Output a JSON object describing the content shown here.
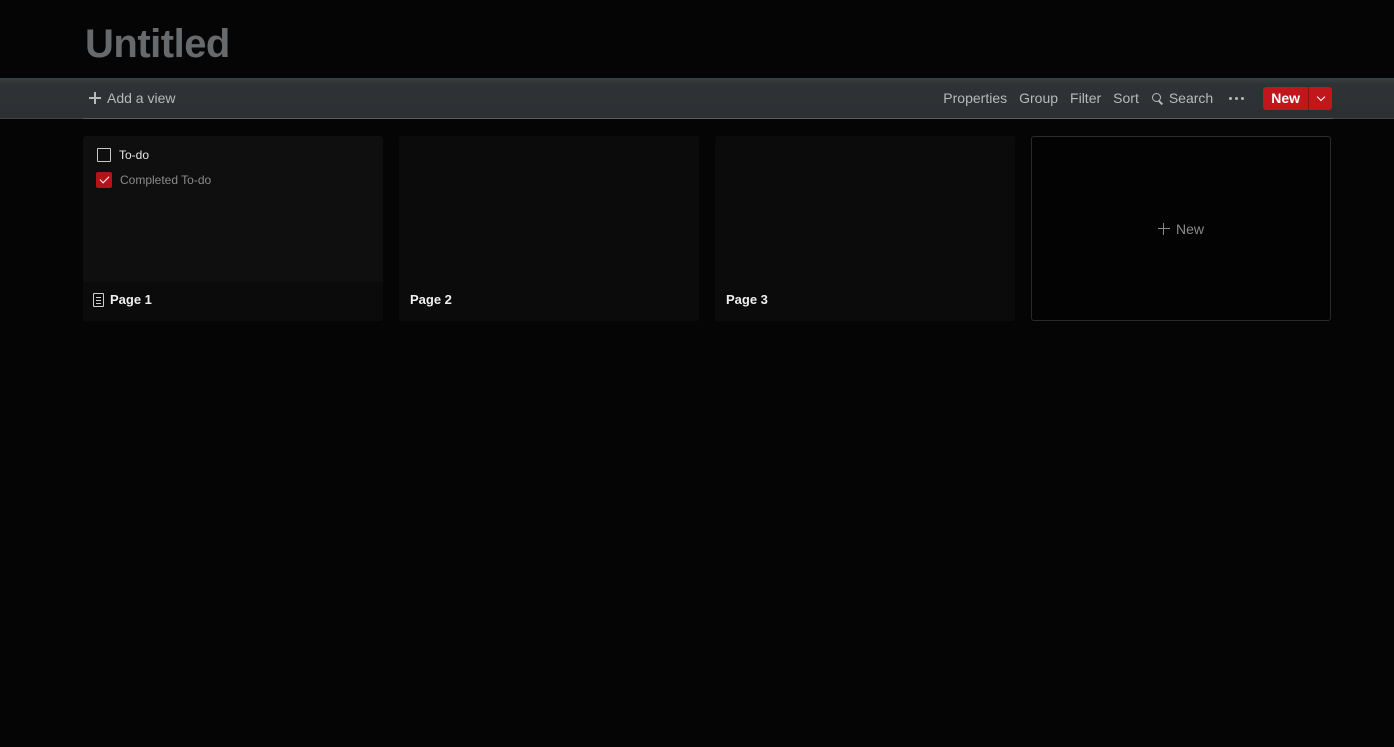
{
  "page": {
    "title": "Untitled"
  },
  "toolbar": {
    "add_view_label": "Add a view",
    "properties_label": "Properties",
    "group_label": "Group",
    "filter_label": "Filter",
    "sort_label": "Sort",
    "search_label": "Search",
    "new_label": "New"
  },
  "cards": [
    {
      "title": "Page 1",
      "todos": [
        {
          "label": "To-do",
          "checked": false
        },
        {
          "label": "Completed To-do",
          "checked": true
        }
      ]
    },
    {
      "title": "Page 2"
    },
    {
      "title": "Page 3"
    }
  ],
  "new_card_label": "New",
  "colors": {
    "accent": "#c0161c",
    "background": "#050505",
    "toolbar": "#2c3033",
    "title_muted": "#666a6d"
  }
}
